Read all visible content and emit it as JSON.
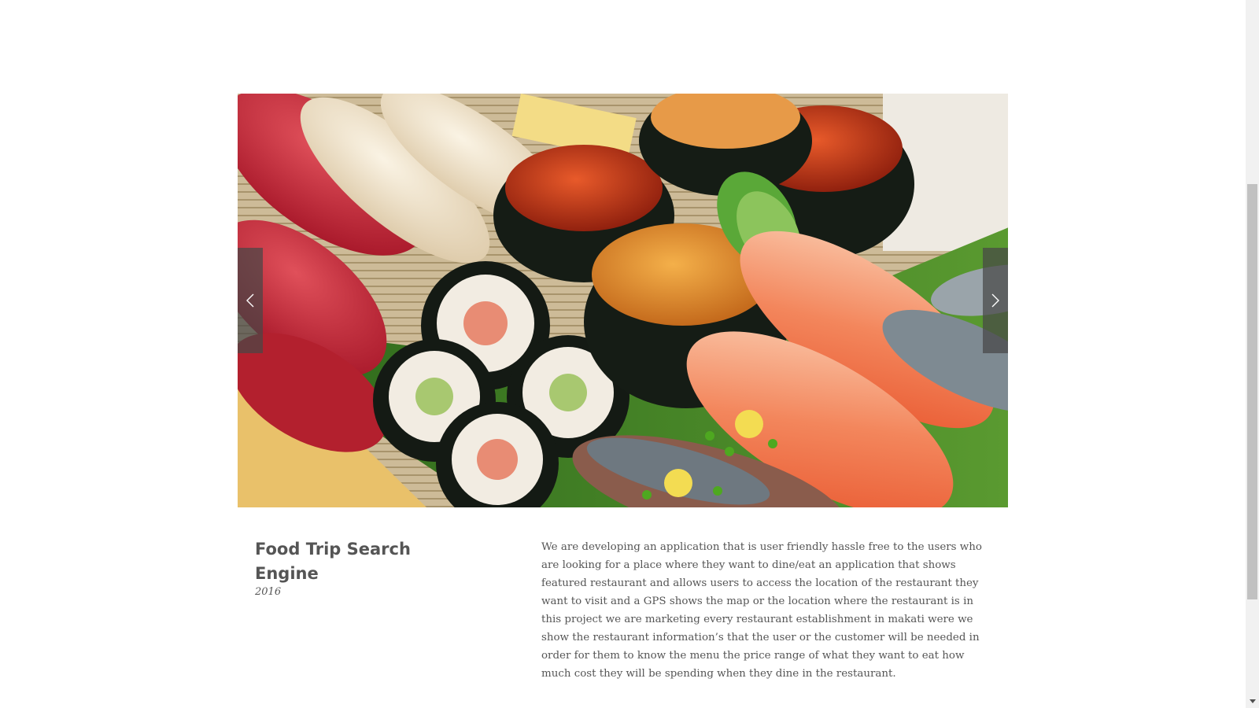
{
  "slider": {
    "image_icon": "sushi-platter-photo",
    "prev_icon": "chevron-left-icon",
    "next_icon": "chevron-right-icon"
  },
  "project": {
    "title": "Food Trip Search Engine",
    "year": "2016",
    "description": "We are developing an application that is user friendly hassle free to the users who are looking for a place where they want to dine/eat an application that shows featured restaurant  and allows users to access the location of the restaurant they want to visit and a GPS shows the map or the location where the restaurant is  in this project we are marketing every restaurant establishment in makati were we show the restaurant information’s that the user or the customer will be needed in order for them to know the menu the price range of what they want to eat how much cost they will be spending when they dine in the restaurant."
  },
  "colors": {
    "text": "#555555",
    "arrow_bg": "#464646",
    "scrollbar_track": "#f1f1f1",
    "scrollbar_thumb": "#c1c1c1"
  }
}
